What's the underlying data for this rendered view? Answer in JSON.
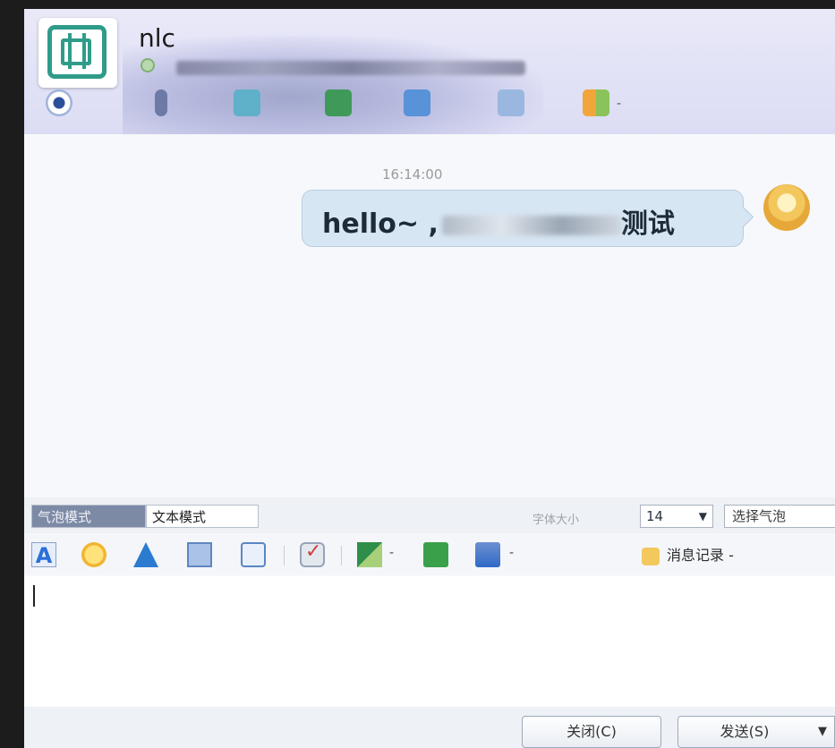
{
  "header": {
    "contact_name": "nlc",
    "toolbar_icons": [
      "eye-icon",
      "microphone-icon",
      "video-icon",
      "screen-share-icon",
      "remote-desktop-icon",
      "file-transfer-icon",
      "apps-icon"
    ]
  },
  "messages": {
    "timestamp": "16:14:00",
    "items": [
      {
        "text": "hello~ ,",
        "tail_text": "测试"
      }
    ]
  },
  "compose": {
    "mode_bubble": "气泡模式",
    "mode_text": "文本模式",
    "font_size_label": "字体大小",
    "font_size_value": "14",
    "choose_bubble": "选择气泡",
    "history_label": "消息记录",
    "input_value": ""
  },
  "footer": {
    "close_label": "关闭(C)",
    "send_label": "发送(S)"
  }
}
